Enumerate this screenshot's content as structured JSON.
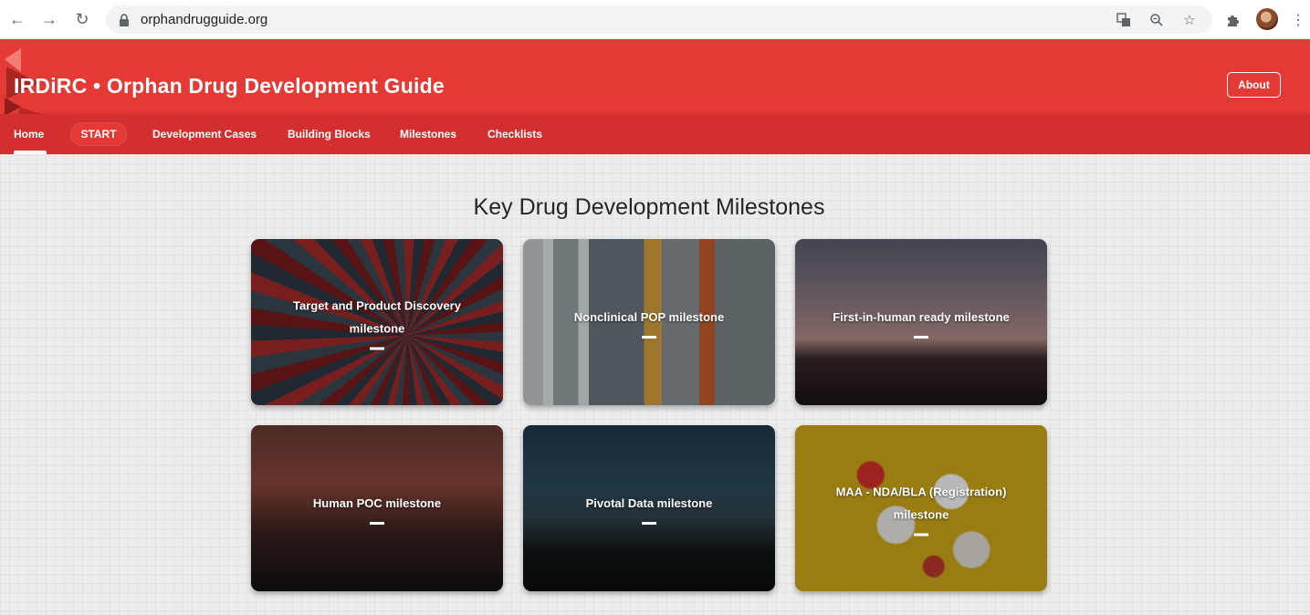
{
  "browser": {
    "url": "orphandrugguide.org"
  },
  "header": {
    "title": "IRDiRC • Orphan Drug Development Guide",
    "about_label": "About",
    "accent": "#e53935"
  },
  "tabs": [
    {
      "label": "Home",
      "active": true
    },
    {
      "label": "START"
    },
    {
      "label": "Development Cases"
    },
    {
      "label": "Building Blocks"
    },
    {
      "label": "Milestones"
    },
    {
      "label": "Checklists"
    }
  ],
  "main": {
    "title": "Key Drug Development Milestones",
    "cards": [
      {
        "label": "Target and Product Discovery milestone"
      },
      {
        "label": "Nonclinical POP milestone"
      },
      {
        "label": "First-in-human ready milestone"
      },
      {
        "label": "Human POC milestone"
      },
      {
        "label": "Pivotal Data milestone"
      },
      {
        "label": "MAA - NDA/BLA (Registration) milestone"
      }
    ]
  }
}
